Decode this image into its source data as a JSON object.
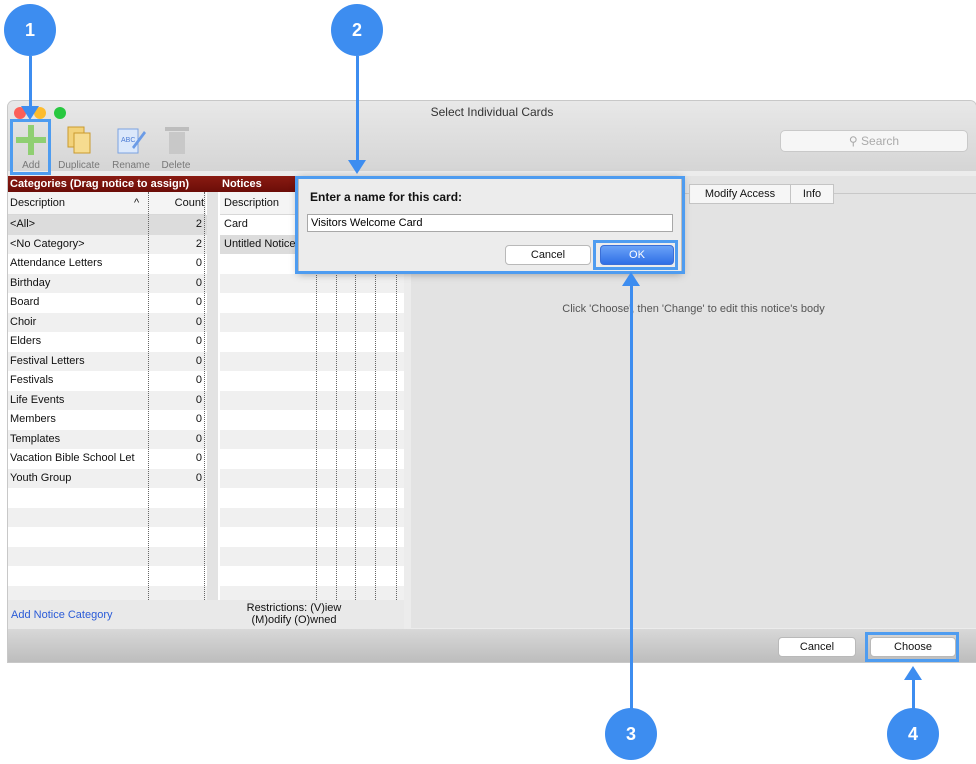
{
  "window": {
    "title": "Select Individual Cards"
  },
  "toolbar": {
    "add": "Add",
    "duplicate": "Duplicate",
    "rename": "Rename",
    "delete": "Delete",
    "search_placeholder": "Search"
  },
  "categories": {
    "header": "Categories (Drag notice to assign)",
    "col_description": "Description",
    "col_count": "Count",
    "sort_indicator": "^",
    "rows": [
      {
        "name": "<All>",
        "count": "2"
      },
      {
        "name": "<No Category>",
        "count": "2"
      },
      {
        "name": "Attendance Letters",
        "count": "0"
      },
      {
        "name": "Birthday",
        "count": "0"
      },
      {
        "name": "Board",
        "count": "0"
      },
      {
        "name": "Choir",
        "count": "0"
      },
      {
        "name": "Elders",
        "count": "0"
      },
      {
        "name": "Festival Letters",
        "count": "0"
      },
      {
        "name": "Festivals",
        "count": "0"
      },
      {
        "name": "Life Events",
        "count": "0"
      },
      {
        "name": "Members",
        "count": "0"
      },
      {
        "name": "Templates",
        "count": "0"
      },
      {
        "name": "Vacation Bible School Let",
        "count": "0"
      },
      {
        "name": "Youth Group",
        "count": "0"
      }
    ],
    "add_category_link": "Add Notice Category"
  },
  "notices": {
    "header": "Notices",
    "col_description": "Description",
    "rows": [
      "Card",
      "Untitled Notice"
    ],
    "restrictions": "Restrictions: (V)iew (M)odify (O)wned"
  },
  "detail": {
    "tabs": [
      "Modify Access",
      "Info"
    ],
    "hint": "Click 'Choose', then 'Change' to edit this notice's body"
  },
  "footer": {
    "cancel": "Cancel",
    "choose": "Choose"
  },
  "dialog": {
    "title": "Enter a name for this card:",
    "value": "Visitors Welcome Card",
    "cancel": "Cancel",
    "ok": "OK"
  },
  "callouts": [
    "1",
    "2",
    "3",
    "4"
  ],
  "colors": {
    "callout": "#3d8df0",
    "header_red": "#7a140c",
    "link": "#2a5bd7"
  }
}
